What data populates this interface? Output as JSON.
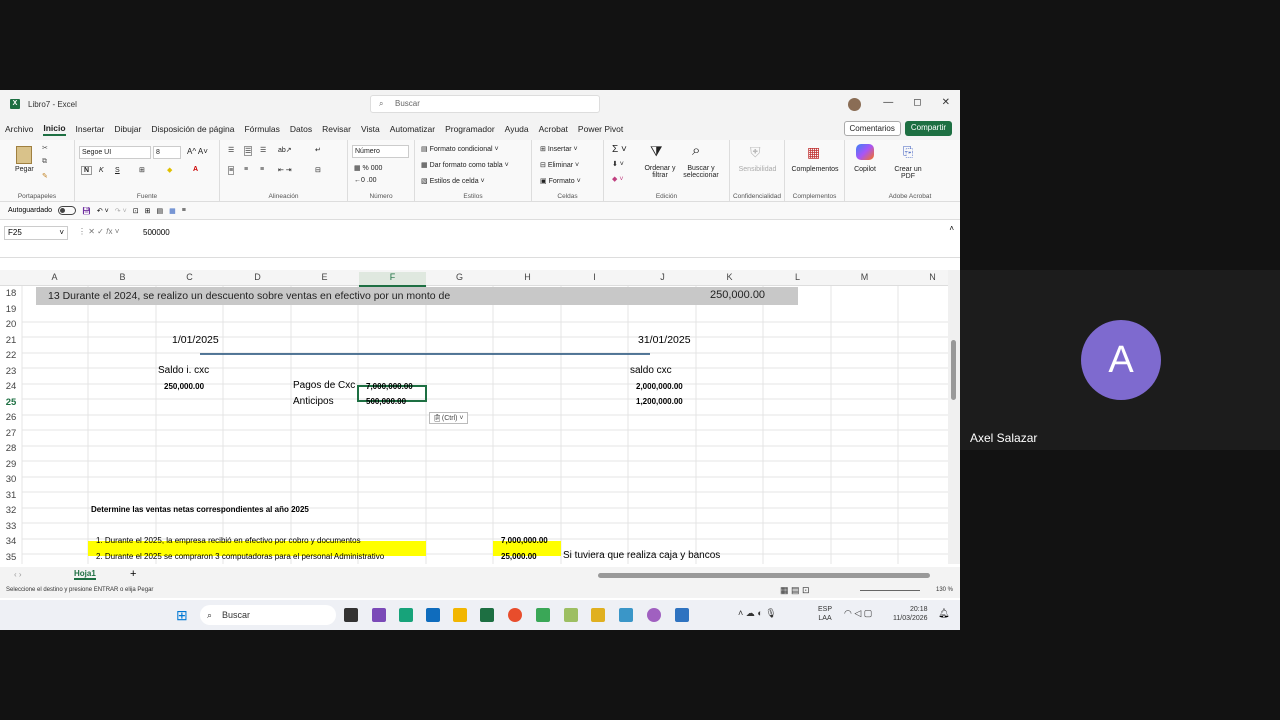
{
  "window": {
    "title": "Libro7 - Excel",
    "search_placeholder": "Buscar"
  },
  "menu": [
    "Archivo",
    "Inicio",
    "Insertar",
    "Dibujar",
    "Disposición de página",
    "Fórmulas",
    "Datos",
    "Revisar",
    "Vista",
    "Automatizar",
    "Programador",
    "Ayuda",
    "Acrobat",
    "Power Pivot"
  ],
  "menu_right": {
    "comments": "Comentarios",
    "share": "Compartir"
  },
  "ribbon": {
    "paste": "Pegar",
    "clipboard": "Portapapeles",
    "font_name": "Segoe UI",
    "font_size": "8",
    "font_group": "Fuente",
    "align_group": "Alineación",
    "number_format": "Número",
    "number_group": "Número",
    "cond_format": "Formato condicional",
    "table_format": "Dar formato como tabla",
    "cell_styles": "Estilos de celda",
    "styles_group": "Estilos",
    "insert": "Insertar",
    "delete": "Eliminar",
    "format": "Formato",
    "cells_group": "Celdas",
    "sort": "Ordenar y filtrar",
    "find": "Buscar y seleccionar",
    "edit_group": "Edición",
    "sensitivity": "Sensibilidad",
    "sensitivity_group": "Confidencialidad",
    "addins": "Complementos",
    "addins_group": "Complementos",
    "copilot": "Copilot",
    "create_pdf": "Crear un PDF",
    "acrobat_group": "Adobe Acrobat"
  },
  "quick_access": {
    "autosave": "Autoguardado"
  },
  "formula_bar": {
    "cell_ref": "F25",
    "value": "500000"
  },
  "columns": [
    "A",
    "B",
    "C",
    "D",
    "E",
    "F",
    "G",
    "H",
    "I",
    "J",
    "K",
    "L",
    "M",
    "N"
  ],
  "rows": [
    "18",
    "19",
    "20",
    "21",
    "22",
    "23",
    "24",
    "25",
    "26",
    "27",
    "28",
    "29",
    "30",
    "31",
    "32",
    "33",
    "34",
    "35"
  ],
  "cells": {
    "r18_text": "13  Durante el 2024, se realizo  un descuento sobre  ventas  en efectivo  por un monto de",
    "r18_amount": "250,000.00",
    "date_start": "1/01/2025",
    "date_end": "31/01/2025",
    "saldo_label": "Saldo i. cxc",
    "saldo_value": "250,000.00",
    "saldo_final_label": "saldo cxc",
    "pagos_label": "Pagos de Cxc",
    "pagos_value": "7,000,000.00",
    "pagos_j": "2,000,000.00",
    "anticipos_label": "Anticipos",
    "anticipos_value": "500,000.00",
    "anticipos_j": "1,200,000.00",
    "paste_ctrl": "(Ctrl)",
    "r32": "Determine las ventas netas correspondientes al año 2025",
    "r34": "1. Durante el 2025, la empresa recibió en efectivo por cobro y documentos",
    "r34_value": "7,000,000.00",
    "r35": "2. Durante el 2025 se compraron 3 computadoras para el personal Administrativo",
    "r35_value": "25,000.00",
    "r35_note": "Si tuviera que realiza caja y bancos"
  },
  "sheet_tab": "Hoja1",
  "status": {
    "message": "Seleccione el destino y presione ENTRAR o elija Pegar",
    "zoom": "130 %"
  },
  "taskbar": {
    "search": "Buscar",
    "lang1": "ESP",
    "lang2": "LAA",
    "time": "20:18",
    "date": "11/03/2026"
  },
  "participant": {
    "initial": "A",
    "name": "Axel Salazar",
    "color": "#7e6acf"
  }
}
